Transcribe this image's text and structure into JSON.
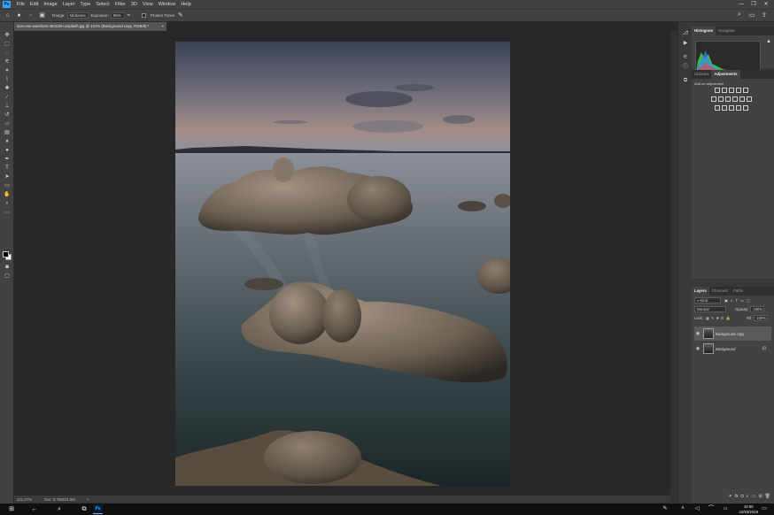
{
  "app": {
    "logo_text": "Ps"
  },
  "menu": [
    "File",
    "Edit",
    "Image",
    "Layer",
    "Type",
    "Select",
    "Filter",
    "3D",
    "View",
    "Window",
    "Help"
  ],
  "options": {
    "range_label": "Range:",
    "range_value": "Midtones",
    "exposure_label": "Exposure:",
    "exposure_value": "96%",
    "protect_label": "Protect Tones"
  },
  "document": {
    "tab_title": "sion-van-waerkom-453135-unsplash.jpg @ 121% (Background copy, RGB/8) *",
    "close": "×"
  },
  "status": {
    "zoom": "121.27%",
    "doc": "Doc: 5.76M/11.5M",
    "arrow": ">"
  },
  "panels": {
    "top_tabs": [
      "Histogram",
      "Navigator"
    ],
    "adj_tabs": [
      "Libraries",
      "Adjustments"
    ],
    "adj_hint": "Add an adjustment",
    "layers_tabs": [
      "Layers",
      "Channels",
      "Paths"
    ],
    "kind_label": "Kind",
    "blend_mode": "Normal",
    "opacity_label": "Opacity:",
    "opacity_value": "100%",
    "lock_label": "Lock:",
    "fill_label": "Fill:",
    "fill_value": "100%"
  },
  "layers": [
    {
      "name": "Background copy",
      "selected": true
    },
    {
      "name": "Background",
      "selected": false
    }
  ],
  "taskbar": {
    "time": "15:55",
    "date": "22/03/2019"
  },
  "colors": {
    "accent": "#31a8ff",
    "panel": "#424242",
    "canvas_bg": "#282828"
  }
}
